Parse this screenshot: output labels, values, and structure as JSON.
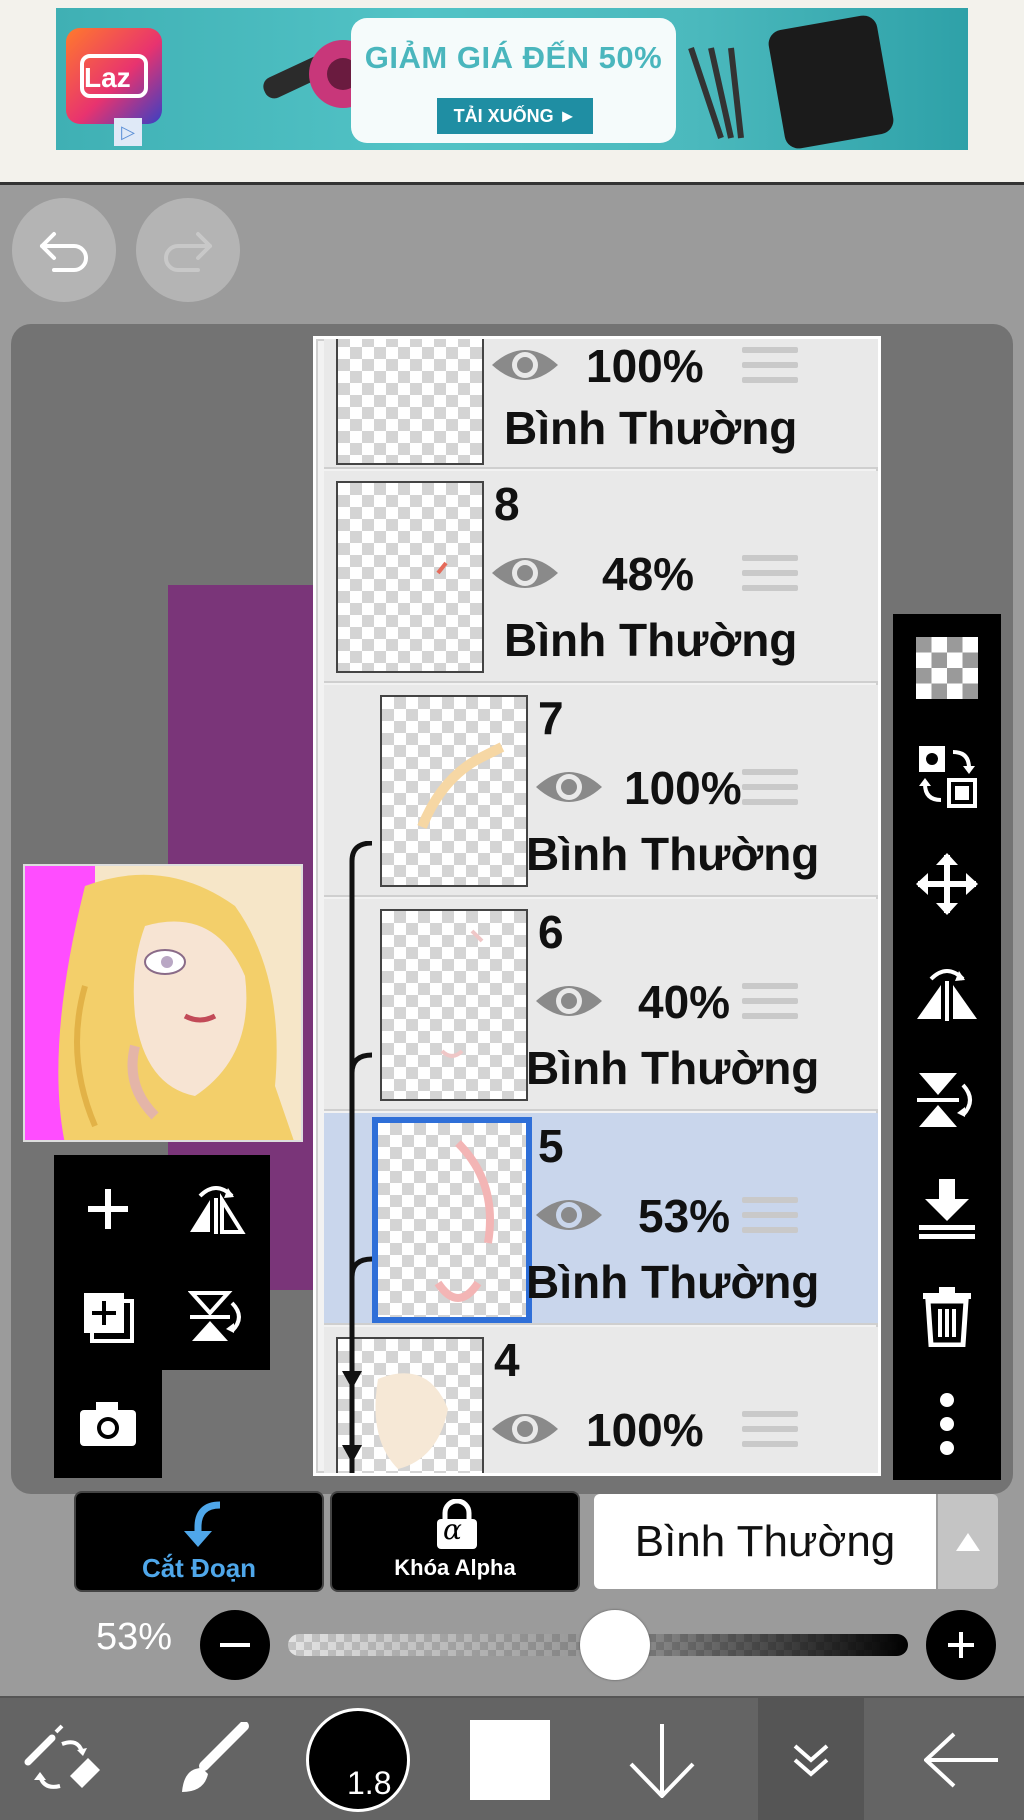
{
  "ad": {
    "logo": "Laz",
    "headline": "GIẢM GIÁ ĐẾN 50%",
    "cta": "TẢI XUỐNG ►",
    "close": "✕"
  },
  "layers": [
    {
      "number": "",
      "opacity": "100%",
      "mode": "Bình Thường",
      "visible": true,
      "clipped": false,
      "selected": false
    },
    {
      "number": "8",
      "opacity": "48%",
      "mode": "Bình Thường",
      "visible": true,
      "clipped": false,
      "selected": false
    },
    {
      "number": "7",
      "opacity": "100%",
      "mode": "Bình Thường",
      "visible": true,
      "clipped": true,
      "selected": false
    },
    {
      "number": "6",
      "opacity": "40%",
      "mode": "Bình Thường",
      "visible": true,
      "clipped": true,
      "selected": false
    },
    {
      "number": "5",
      "opacity": "53%",
      "mode": "Bình Thường",
      "visible": true,
      "clipped": true,
      "selected": true
    },
    {
      "number": "4",
      "opacity": "100%",
      "mode": "",
      "visible": true,
      "clipped": false,
      "selected": false
    }
  ],
  "controls": {
    "clipping_label": "Cắt Đoạn",
    "alpha_lock_label": "Khóa Alpha",
    "alpha_symbol": "α",
    "blend_mode": "Bình Thường",
    "opacity_label": "53%",
    "opacity_value": 0.53
  },
  "toolbar": {
    "brush_size": "1.8"
  },
  "colors": {
    "accent_blue": "#2f6fd8",
    "clip_blue": "#4fa7ea",
    "purple": "#7a3579",
    "magenta": "#ff4dff"
  }
}
